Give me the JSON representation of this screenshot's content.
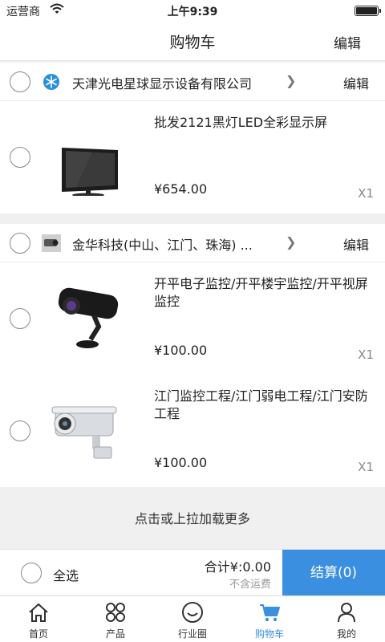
{
  "status_bar": {
    "carrier": "运营商",
    "time": "上午9:39",
    "wifi_icon": "wifi-icon",
    "battery_icon": "battery-icon"
  },
  "nav": {
    "title": "购物车",
    "edit_label": "编辑"
  },
  "shops": [
    {
      "name": "天津光电星球显示设备有限公司",
      "edit_label": "编辑",
      "logo_icon": "snowflake-logo-icon",
      "items": [
        {
          "title": "批发2121黑灯LED全彩显示屏",
          "price": "¥654.00",
          "qty": "X1",
          "image": "monitor-image"
        }
      ]
    },
    {
      "name": "金华科技(中山、江门、珠海) ...",
      "edit_label": "编辑",
      "logo_icon": "camera-logo-icon",
      "items": [
        {
          "title": "开平电子监控/开平楼宇监控/开平视屏监控",
          "price": "¥100.00",
          "qty": "X1",
          "image": "black-camera-image"
        },
        {
          "title": "江门监控工程/江门弱电工程/江门安防工程",
          "price": "¥100.00",
          "qty": "X1",
          "image": "white-camera-image"
        }
      ]
    }
  ],
  "load_more": "点击或上拉加载更多",
  "checkout": {
    "select_all": "全选",
    "total": "合计¥:0.00",
    "shipping": "不含运费",
    "button": "结算(0)"
  },
  "tabs": [
    {
      "label": "首页",
      "icon": "home-icon"
    },
    {
      "label": "产品",
      "icon": "grid-icon"
    },
    {
      "label": "行业圈",
      "icon": "smiley-icon"
    },
    {
      "label": "购物车",
      "icon": "cart-icon",
      "active": true
    },
    {
      "label": "我的",
      "icon": "person-icon"
    }
  ],
  "colors": {
    "accent": "#3b8fe0",
    "background": "#f0f0f0"
  }
}
